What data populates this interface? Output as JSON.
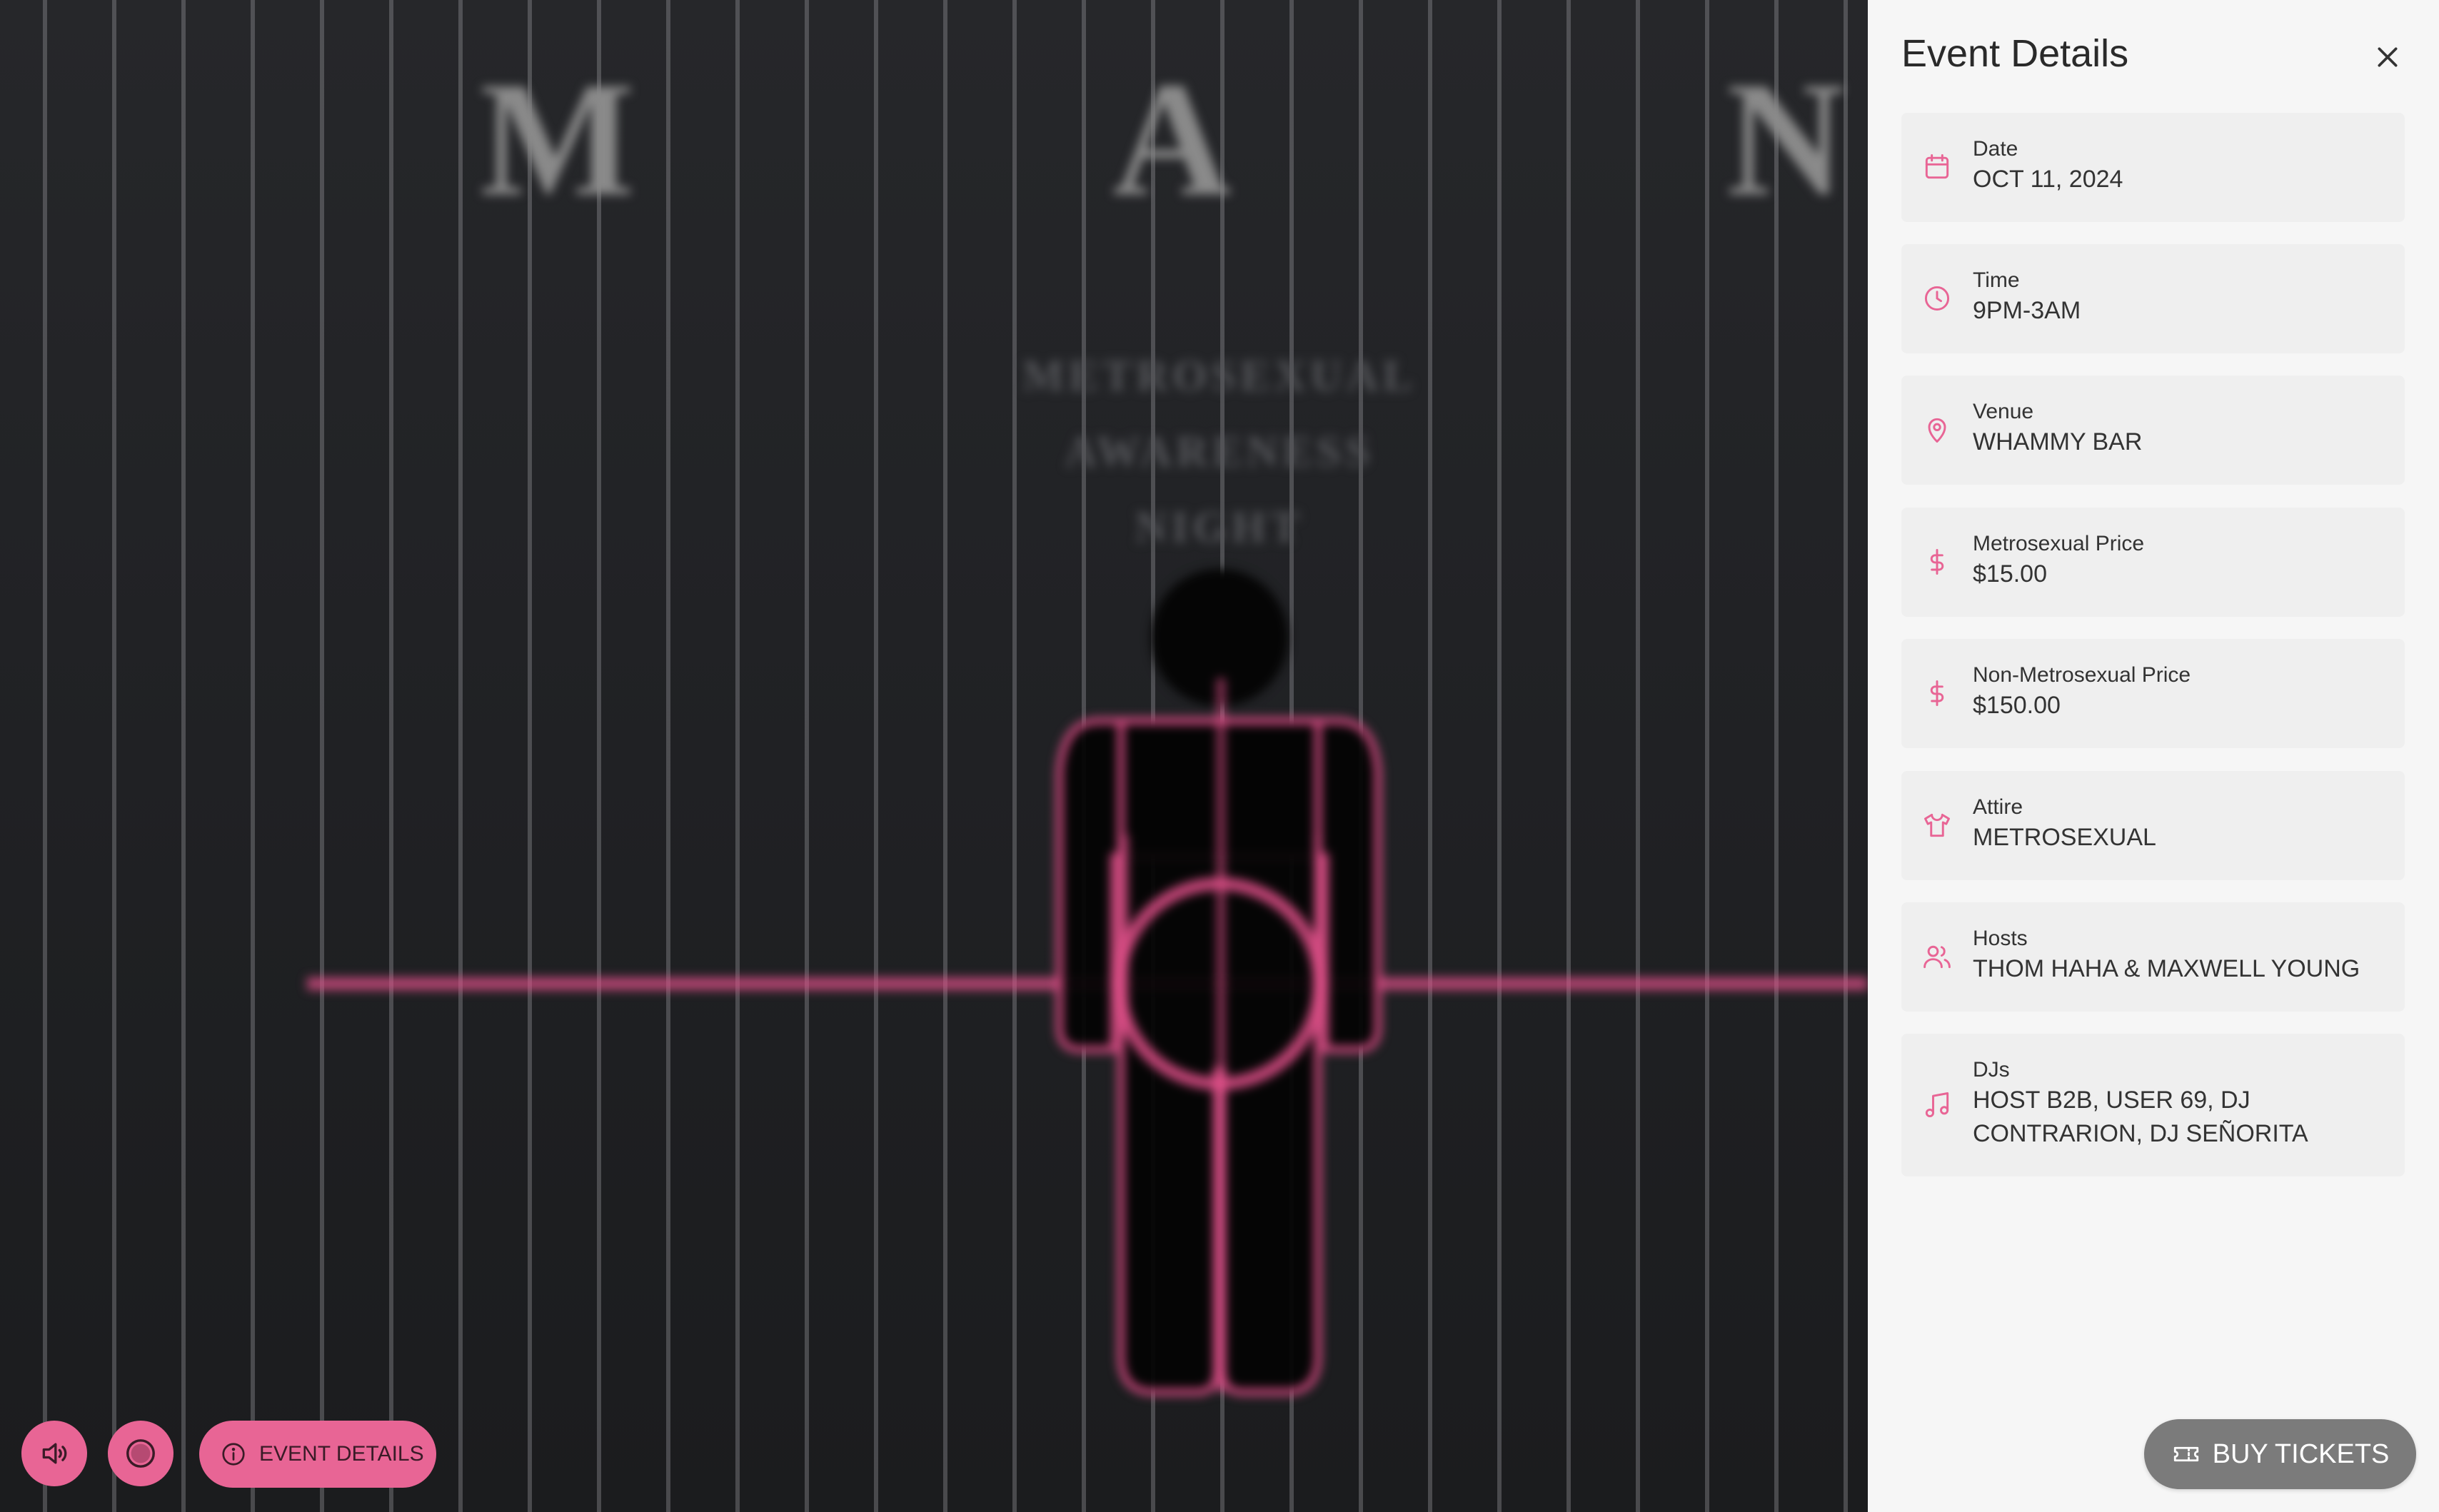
{
  "poster": {
    "letters": [
      "M",
      "A",
      "N"
    ],
    "subtitle_lines": [
      "METROSEXUAL",
      "AWARENESS",
      "NIGHT"
    ]
  },
  "controls": {
    "sound_icon": "speaker-icon",
    "record_icon": "target-circle-icon",
    "event_details_label": "EVENT DETAILS",
    "event_details_icon": "info-icon"
  },
  "panel": {
    "title": "Event Details",
    "close_icon": "close-icon",
    "items": [
      {
        "label": "Date",
        "value": "OCT 11, 2024",
        "icon": "calendar-icon"
      },
      {
        "label": "Time",
        "value": "9PM-3AM",
        "icon": "clock-icon"
      },
      {
        "label": "Venue",
        "value": "WHAMMY BAR",
        "icon": "map-pin-icon"
      },
      {
        "label": "Metrosexual Price",
        "value": "$15.00",
        "icon": "dollar-icon"
      },
      {
        "label": "Non-Metrosexual Price",
        "value": "$150.00",
        "icon": "dollar-icon"
      },
      {
        "label": "Attire",
        "value": "METROSEXUAL",
        "icon": "shirt-icon"
      },
      {
        "label": "Hosts",
        "value": "THOM HAHA & MAXWELL YOUNG",
        "icon": "users-icon"
      },
      {
        "label": "DJs",
        "value": "HOST B2B, USER 69, DJ CONTRARION, DJ SEÑORITA",
        "icon": "music-note-icon"
      }
    ],
    "buy_tickets_label": "BUY TICKETS",
    "buy_tickets_icon": "ticket-icon"
  },
  "colors": {
    "accent_pink": "#e86595",
    "panel_bg": "#f6f6f6",
    "card_bg": "#efefef",
    "buy_button_bg": "#7b7b7b"
  }
}
